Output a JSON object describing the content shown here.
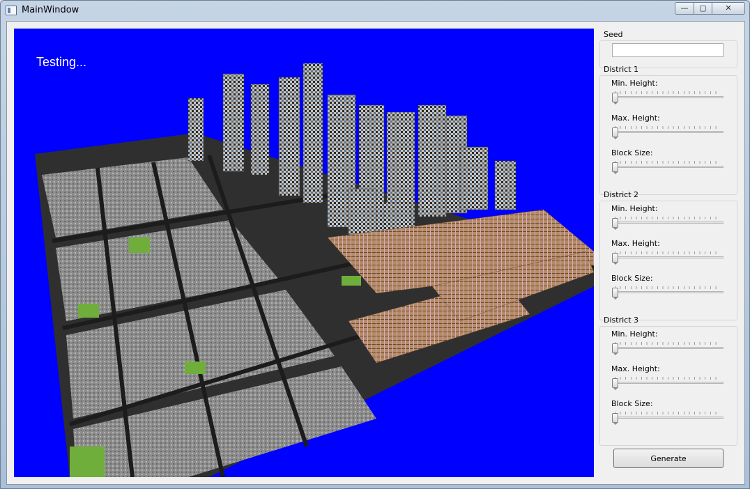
{
  "window": {
    "title": "MainWindow",
    "controls": {
      "minimize": "—",
      "maximize": "▢",
      "close": "✕"
    }
  },
  "viewport": {
    "overlay_text": "Testing..."
  },
  "panel": {
    "seed": {
      "label": "Seed",
      "value": ""
    },
    "districts": [
      {
        "title": "District 1",
        "sliders": [
          {
            "label": "Min. Height:",
            "value": 0
          },
          {
            "label": "Max. Height:",
            "value": 0
          },
          {
            "label": "Block Size:",
            "value": 0
          }
        ]
      },
      {
        "title": "District 2",
        "sliders": [
          {
            "label": "Min. Height:",
            "value": 0
          },
          {
            "label": "Max. Height:",
            "value": 0
          },
          {
            "label": "Block Size:",
            "value": 0
          }
        ]
      },
      {
        "title": "District 3",
        "sliders": [
          {
            "label": "Min. Height:",
            "value": 0
          },
          {
            "label": "Max. Height:",
            "value": 0
          },
          {
            "label": "Block Size:",
            "value": 0
          }
        ]
      }
    ],
    "generate_label": "Generate"
  },
  "colors": {
    "viewport_bg": "#0000ff",
    "road": "#2a2a2a",
    "block": "#8a8a8a",
    "park": "#6fae3a",
    "tower": "#b8b4ac",
    "house": "#b88a5c"
  }
}
